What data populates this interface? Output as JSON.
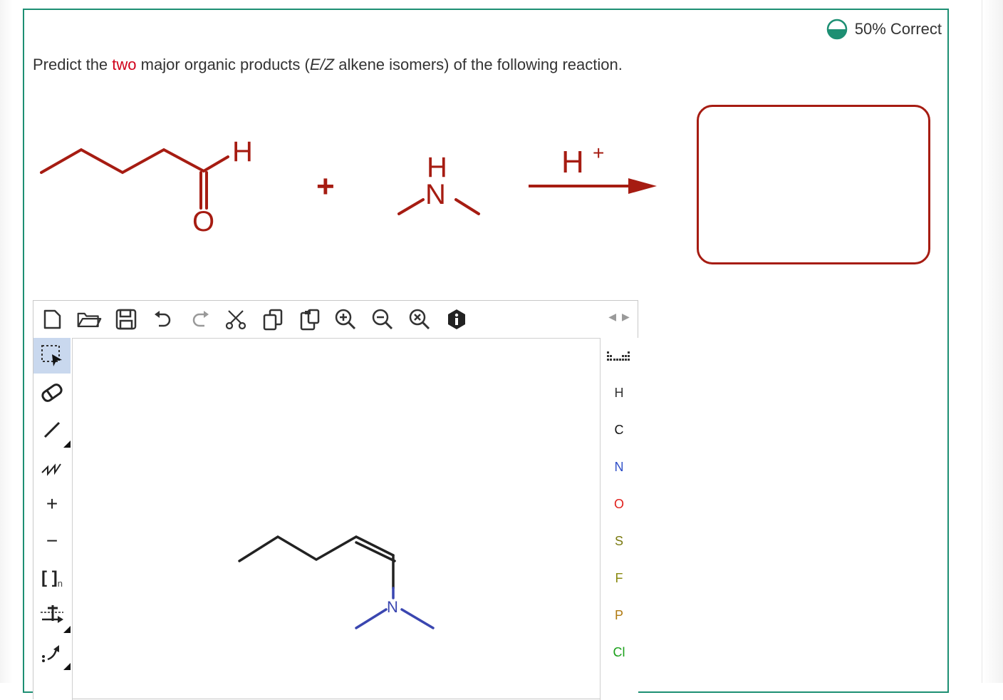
{
  "score": {
    "label": "50% Correct",
    "fraction": 0.5,
    "color": "#1d8f73"
  },
  "question": {
    "prefix": "Predict the ",
    "highlight": "two",
    "middle": " major organic products (",
    "italic": "E/Z",
    "suffix": " alkene isomers) of the following reaction."
  },
  "reaction": {
    "reactant1": {
      "atom_o": "O",
      "atom_h": "H"
    },
    "plus": "+",
    "reactant2": {
      "atom_h": "H",
      "atom_n": "N"
    },
    "reagent": "H",
    "reagent_charge": "+",
    "color": "#a61c12"
  },
  "editor": {
    "top_toolbar": [
      {
        "name": "new-document-icon"
      },
      {
        "name": "open-folder-icon"
      },
      {
        "name": "save-icon"
      },
      {
        "name": "undo-icon"
      },
      {
        "name": "redo-icon"
      },
      {
        "name": "cut-icon"
      },
      {
        "name": "copy-icon"
      },
      {
        "name": "paste-icon"
      },
      {
        "name": "zoom-in-icon"
      },
      {
        "name": "zoom-out-icon"
      },
      {
        "name": "zoom-reset-icon"
      },
      {
        "name": "info-icon"
      }
    ],
    "left_toolbar": [
      {
        "name": "select-tool-icon",
        "active": true
      },
      {
        "name": "eraser-icon"
      },
      {
        "name": "single-bond-icon"
      },
      {
        "name": "chain-tool-icon"
      },
      {
        "name": "positive-charge-icon",
        "label": "+"
      },
      {
        "name": "negative-charge-icon",
        "label": "−"
      },
      {
        "name": "bracket-tool-icon",
        "label": "[ ]",
        "sub": "n"
      },
      {
        "name": "reaction-arrow-icon"
      },
      {
        "name": "electron-flow-icon"
      }
    ],
    "elements": [
      {
        "symbol": "H",
        "color": "#333333"
      },
      {
        "symbol": "C",
        "color": "#111111"
      },
      {
        "symbol": "N",
        "color": "#3050c8"
      },
      {
        "symbol": "O",
        "color": "#e0201c"
      },
      {
        "symbol": "S",
        "color": "#7a7a10"
      },
      {
        "symbol": "F",
        "color": "#8a8a10"
      },
      {
        "symbol": "P",
        "color": "#b07a10"
      },
      {
        "symbol": "Cl",
        "color": "#1aa01a"
      }
    ],
    "canvas_molecule": {
      "atom_n": "N",
      "n_color": "#3a46b0"
    }
  }
}
